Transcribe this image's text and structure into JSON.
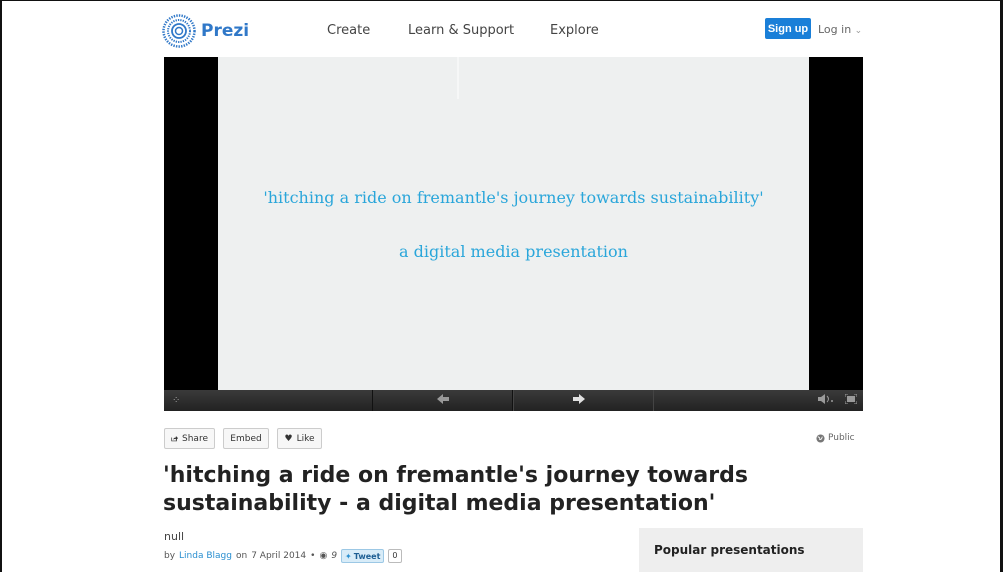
{
  "header": {
    "brand": "Prezi",
    "nav": [
      "Create",
      "Learn & Support",
      "Explore"
    ],
    "signup_label": "Sign up",
    "login_label": "Log in",
    "login_chevron": "⌄"
  },
  "slide": {
    "line1": "'hitching a ride on fremantle's journey towards sustainability'",
    "line2": "a digital media presentation"
  },
  "controls": {
    "icons": [
      "spinner-icon",
      "arrow-left-icon",
      "arrow-right-icon",
      "volume-icon",
      "fullscreen-icon"
    ]
  },
  "actions": {
    "share_label": "Share",
    "embed_label": "Embed",
    "like_label": "Like",
    "visibility_label": "Public"
  },
  "presentation": {
    "title": "'hitching a ride on fremantle's journey towards sustainability - a digital media presentation'",
    "description": "null",
    "by_prefix": "by",
    "author": "Linda Blagg",
    "on_prefix": "on",
    "date": "7 April 2014",
    "bullet": "•",
    "views": "9",
    "tweet_label": "Tweet",
    "tweet_count": "0"
  },
  "sidebar": {
    "popular_title": "Popular presentations"
  },
  "colors": {
    "brand": "#3078c8",
    "signup": "#1a7fd8",
    "slide_text": "#2aa6da",
    "link": "#2a8fd0"
  }
}
